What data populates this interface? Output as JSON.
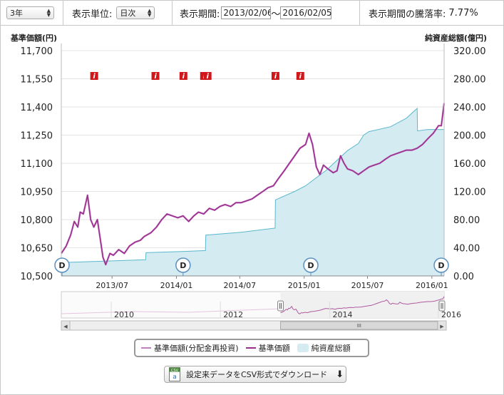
{
  "toolbar": {
    "period_select": "3年",
    "unit_label": "表示単位:",
    "unit_select": "日次",
    "range_label": "表示期間:",
    "date_from": "2013/02/06",
    "range_sep": "〜",
    "date_to": "2016/02/05",
    "change_label": "表示期間の騰落率:",
    "change_value": "7.77%"
  },
  "colors": {
    "nav_reinvested": "#c47fc4",
    "nav": "#9b2f8f",
    "net_assets_fill": "#d3ebf1",
    "net_assets_line": "#5bb8cc",
    "info_marker": "#d0181b",
    "navigator_line": "#b05aa0"
  },
  "chart_data": {
    "type": "line",
    "y_left_title": "基準価額(円)",
    "y_right_title": "純資産総額(億円)",
    "y_left_ticks": [
      "11,700",
      "11,550",
      "11,400",
      "11,250",
      "11,100",
      "10,950",
      "10,800",
      "10,650",
      "10,500"
    ],
    "y_left_range": [
      10500,
      11700
    ],
    "y_right_ticks": [
      "320.00",
      "280.00",
      "240.00",
      "200.00",
      "160.00",
      "120.00",
      "80.00",
      "40.00",
      "0.00"
    ],
    "y_right_range": [
      0,
      320
    ],
    "x_tick_labels": [
      "2013/07",
      "2014/01",
      "2014/07",
      "2015/01",
      "2015/07",
      "2016/01"
    ],
    "x_range": [
      "2013/02/06",
      "2016/02/05"
    ],
    "series": [
      {
        "name": "基準価額",
        "axis": "left",
        "points": [
          [
            "2013/02/06",
            10620
          ],
          [
            "2013/02/20",
            10660
          ],
          [
            "2013/03/05",
            10720
          ],
          [
            "2013/03/15",
            10790
          ],
          [
            "2013/03/25",
            10760
          ],
          [
            "2013/04/01",
            10840
          ],
          [
            "2013/04/10",
            10830
          ],
          [
            "2013/04/22",
            10930
          ],
          [
            "2013/05/01",
            10800
          ],
          [
            "2013/05/10",
            10760
          ],
          [
            "2013/05/20",
            10800
          ],
          [
            "2013/05/28",
            10700
          ],
          [
            "2013/06/05",
            10600
          ],
          [
            "2013/06/13",
            10560
          ],
          [
            "2013/06/25",
            10620
          ],
          [
            "2013/07/05",
            10610
          ],
          [
            "2013/07/20",
            10640
          ],
          [
            "2013/08/05",
            10620
          ],
          [
            "2013/08/20",
            10660
          ],
          [
            "2013/09/05",
            10680
          ],
          [
            "2013/09/20",
            10690
          ],
          [
            "2013/10/01",
            10710
          ],
          [
            "2013/10/20",
            10730
          ],
          [
            "2013/11/05",
            10760
          ],
          [
            "2013/11/20",
            10800
          ],
          [
            "2013/12/05",
            10830
          ],
          [
            "2013/12/20",
            10820
          ],
          [
            "2014/01/05",
            10810
          ],
          [
            "2014/01/20",
            10820
          ],
          [
            "2014/02/05",
            10790
          ],
          [
            "2014/02/20",
            10820
          ],
          [
            "2014/03/05",
            10840
          ],
          [
            "2014/03/20",
            10830
          ],
          [
            "2014/04/05",
            10860
          ],
          [
            "2014/04/20",
            10850
          ],
          [
            "2014/05/05",
            10870
          ],
          [
            "2014/05/20",
            10880
          ],
          [
            "2014/06/05",
            10870
          ],
          [
            "2014/06/20",
            10890
          ],
          [
            "2014/07/05",
            10890
          ],
          [
            "2014/07/20",
            10900
          ],
          [
            "2014/08/05",
            10910
          ],
          [
            "2014/08/20",
            10930
          ],
          [
            "2014/09/05",
            10950
          ],
          [
            "2014/09/20",
            10970
          ],
          [
            "2014/10/05",
            10980
          ],
          [
            "2014/10/20",
            11020
          ],
          [
            "2014/11/05",
            11060
          ],
          [
            "2014/11/20",
            11100
          ],
          [
            "2014/12/05",
            11140
          ],
          [
            "2014/12/20",
            11180
          ],
          [
            "2015/01/05",
            11200
          ],
          [
            "2015/01/15",
            11260
          ],
          [
            "2015/01/25",
            11200
          ],
          [
            "2015/02/05",
            11080
          ],
          [
            "2015/02/15",
            11040
          ],
          [
            "2015/02/25",
            11090
          ],
          [
            "2015/03/10",
            11070
          ],
          [
            "2015/03/25",
            11050
          ],
          [
            "2015/04/05",
            11060
          ],
          [
            "2015/04/15",
            11140
          ],
          [
            "2015/04/25",
            11100
          ],
          [
            "2015/05/05",
            11070
          ],
          [
            "2015/05/20",
            11060
          ],
          [
            "2015/06/05",
            11040
          ],
          [
            "2015/06/20",
            11060
          ],
          [
            "2015/07/05",
            11080
          ],
          [
            "2015/07/20",
            11090
          ],
          [
            "2015/08/05",
            11100
          ],
          [
            "2015/08/20",
            11120
          ],
          [
            "2015/09/05",
            11140
          ],
          [
            "2015/09/20",
            11150
          ],
          [
            "2015/10/05",
            11160
          ],
          [
            "2015/10/20",
            11170
          ],
          [
            "2015/11/05",
            11170
          ],
          [
            "2015/11/20",
            11180
          ],
          [
            "2015/12/05",
            11200
          ],
          [
            "2015/12/20",
            11230
          ],
          [
            "2016/01/05",
            11260
          ],
          [
            "2016/01/20",
            11300
          ],
          [
            "2016/01/28",
            11300
          ],
          [
            "2016/02/05",
            11420
          ]
        ]
      },
      {
        "name": "純資産総額",
        "axis": "right",
        "points": [
          [
            "2013/02/06",
            19
          ],
          [
            "2013/06/10",
            21
          ],
          [
            "2013/10/05",
            23
          ],
          [
            "2013/10/06",
            33
          ],
          [
            "2014/02/05",
            35
          ],
          [
            "2014/03/25",
            36
          ],
          [
            "2014/03/26",
            58
          ],
          [
            "2014/07/05",
            62
          ],
          [
            "2014/10/10",
            68
          ],
          [
            "2014/10/11",
            108
          ],
          [
            "2014/12/05",
            120
          ],
          [
            "2015/01/05",
            128
          ],
          [
            "2015/03/05",
            150
          ],
          [
            "2015/05/05",
            178
          ],
          [
            "2015/06/05",
            188
          ],
          [
            "2015/06/20",
            200
          ],
          [
            "2015/07/05",
            205
          ],
          [
            "2015/09/05",
            212
          ],
          [
            "2015/10/20",
            224
          ],
          [
            "2015/11/20",
            238
          ],
          [
            "2015/11/21",
            206
          ],
          [
            "2015/12/20",
            208
          ],
          [
            "2016/02/05",
            208
          ]
        ]
      }
    ],
    "legend": [
      "基準価額(分配金再投資)",
      "基準価額",
      "純資産総額"
    ],
    "legend_position": "bottom",
    "info_markers": [
      "2013/05/10",
      "2013/11/01",
      "2014/01/20",
      "2014/03/20",
      "2014/03/30",
      "2014/10/10",
      "2014/12/20"
    ],
    "dividend_markers": [
      "2013/02/06",
      "2014/01/20",
      "2015/01/20",
      "2016/02/05"
    ],
    "navigator": {
      "labels": [
        "2010",
        "2012",
        "2014",
        "2016"
      ],
      "range": [
        "2009/02/01",
        "2016/02/05"
      ]
    }
  },
  "marker_labels": {
    "info": "i",
    "dividend": "D"
  },
  "download": {
    "icon_text": "CSV",
    "label": "設定来データをCSV形式でダウンロード"
  },
  "scrollbar": {
    "left_arrow": "◀",
    "right_arrow": "▶"
  }
}
